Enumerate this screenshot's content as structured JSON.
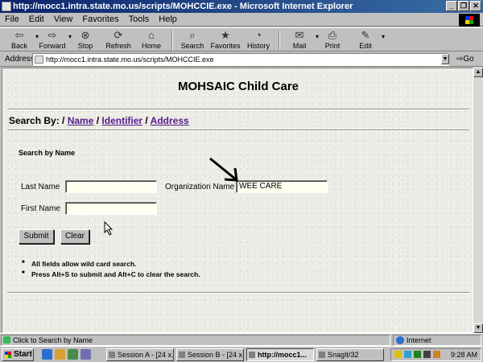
{
  "window": {
    "title": "http://mocc1.intra.state.mo.us/scripts/MOHCCIE.exe - Microsoft Internet Explorer",
    "controls": [
      "_",
      "❐",
      "✕"
    ]
  },
  "menu": [
    "File",
    "Edit",
    "View",
    "Favorites",
    "Tools",
    "Help"
  ],
  "toolbar": [
    {
      "label": "Back",
      "icon": "back-arrow-icon",
      "glyph": "⇦"
    },
    {
      "label": "Forward",
      "icon": "forward-arrow-icon",
      "glyph": "⇨"
    },
    {
      "label": "Stop",
      "icon": "stop-icon",
      "glyph": "⊗"
    },
    {
      "label": "Refresh",
      "icon": "refresh-icon",
      "glyph": "⟳"
    },
    {
      "label": "Home",
      "icon": "home-icon",
      "glyph": "⌂"
    },
    {
      "label": "Search",
      "icon": "search-icon",
      "glyph": "⌕"
    },
    {
      "label": "Favorites",
      "icon": "favorites-icon",
      "glyph": "★"
    },
    {
      "label": "History",
      "icon": "history-icon",
      "glyph": "◔"
    },
    {
      "label": "Mail",
      "icon": "mail-icon",
      "glyph": "✉"
    },
    {
      "label": "Print",
      "icon": "print-icon",
      "glyph": "⎙"
    },
    {
      "label": "Edit",
      "icon": "edit-icon",
      "glyph": "✎"
    }
  ],
  "address": {
    "label": "Address",
    "url": "http://mocc1.intra.state.mo.us/scripts/MOHCCIE.exe",
    "go_label": "Go"
  },
  "page": {
    "title": "MOHSAIC Child Care",
    "search_by_prefix": "Search By: /",
    "links": [
      "Name",
      "Identifier",
      "Address"
    ],
    "section_title": "Search by Name",
    "fields": {
      "last_name_label": "Last Name",
      "last_name_value": "",
      "org_name_label": "Organization Name",
      "org_name_value": "WEE CARE",
      "first_name_label": "First Name",
      "first_name_value": ""
    },
    "buttons": {
      "submit": "Submit",
      "clear": "Clear"
    },
    "notes": [
      "All fields allow wild card search.",
      "Press Alt+S to submit and Alt+C to clear the search."
    ]
  },
  "status": {
    "text": "Click to Search by Name",
    "zone": "Internet"
  },
  "taskbar": {
    "start": "Start",
    "tasks": [
      "Session A - [24 x...",
      "Session B - [24 x...",
      "http://mocc1...",
      "SnagIt/32"
    ],
    "clock": "9:28 AM"
  }
}
